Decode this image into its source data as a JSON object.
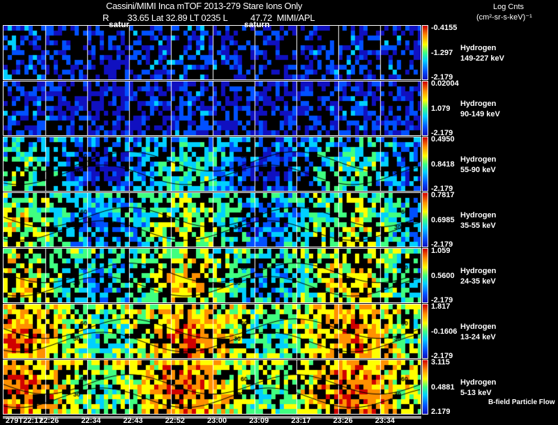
{
  "header": {
    "title": "Cassini/MIMI Inca mTOF  2013-279   Stare   Ions Only",
    "subtitle": "R        33.65 Lat 32.89 LT 0235 L          47.72  MIMI/APL",
    "saturn_labels": [
      "satur",
      "saturn"
    ],
    "units_line1": "Log Cnts",
    "units_line2": "(cm²-sr-s-keV)⁻¹"
  },
  "chart_data": {
    "type": "heatmap",
    "panels": [
      {
        "species": "Hydrogen",
        "energy": "149-227 keV",
        "cbar_max": "-0.4155",
        "cbar_mid": "-1.297",
        "cbar_min": "-2.179"
      },
      {
        "species": "Hydrogen",
        "energy": "90-149 keV",
        "cbar_max": "0.02004",
        "cbar_mid": "1.079",
        "cbar_min": "-2.179"
      },
      {
        "species": "Hydrogen",
        "energy": "55-90 keV",
        "cbar_max": "0.4950",
        "cbar_mid": "0.8418",
        "cbar_min": "-2.179"
      },
      {
        "species": "Hydrogen",
        "energy": "35-55 keV",
        "cbar_max": "0.7817",
        "cbar_mid": "0.6985",
        "cbar_min": "-2.179"
      },
      {
        "species": "Hydrogen",
        "energy": "24-35 keV",
        "cbar_max": "1.059",
        "cbar_mid": "0.5600",
        "cbar_min": "-2.179"
      },
      {
        "species": "Hydrogen",
        "energy": "13-24 keV",
        "cbar_max": "1.817",
        "cbar_mid": "-0.1606",
        "cbar_min": "-2.179"
      },
      {
        "species": "Hydrogen",
        "energy": "5-13 keV",
        "cbar_max": "3.115",
        "cbar_mid": "0.4881",
        "cbar_min": "2.179"
      }
    ],
    "x_tick_labels": [
      "279T22:17",
      "22:26",
      "22:34",
      "22:43",
      "22:52",
      "23:00",
      "23:09",
      "23:17",
      "23:26",
      "23:34"
    ],
    "contour_labels": [
      "30",
      "60"
    ],
    "colormap": [
      "#1010c0",
      "#0050ff",
      "#00d0ff",
      "#40ff80",
      "#ffff00",
      "#ff9000",
      "#d00000"
    ],
    "footer_label": "B-field Particle Flow"
  }
}
